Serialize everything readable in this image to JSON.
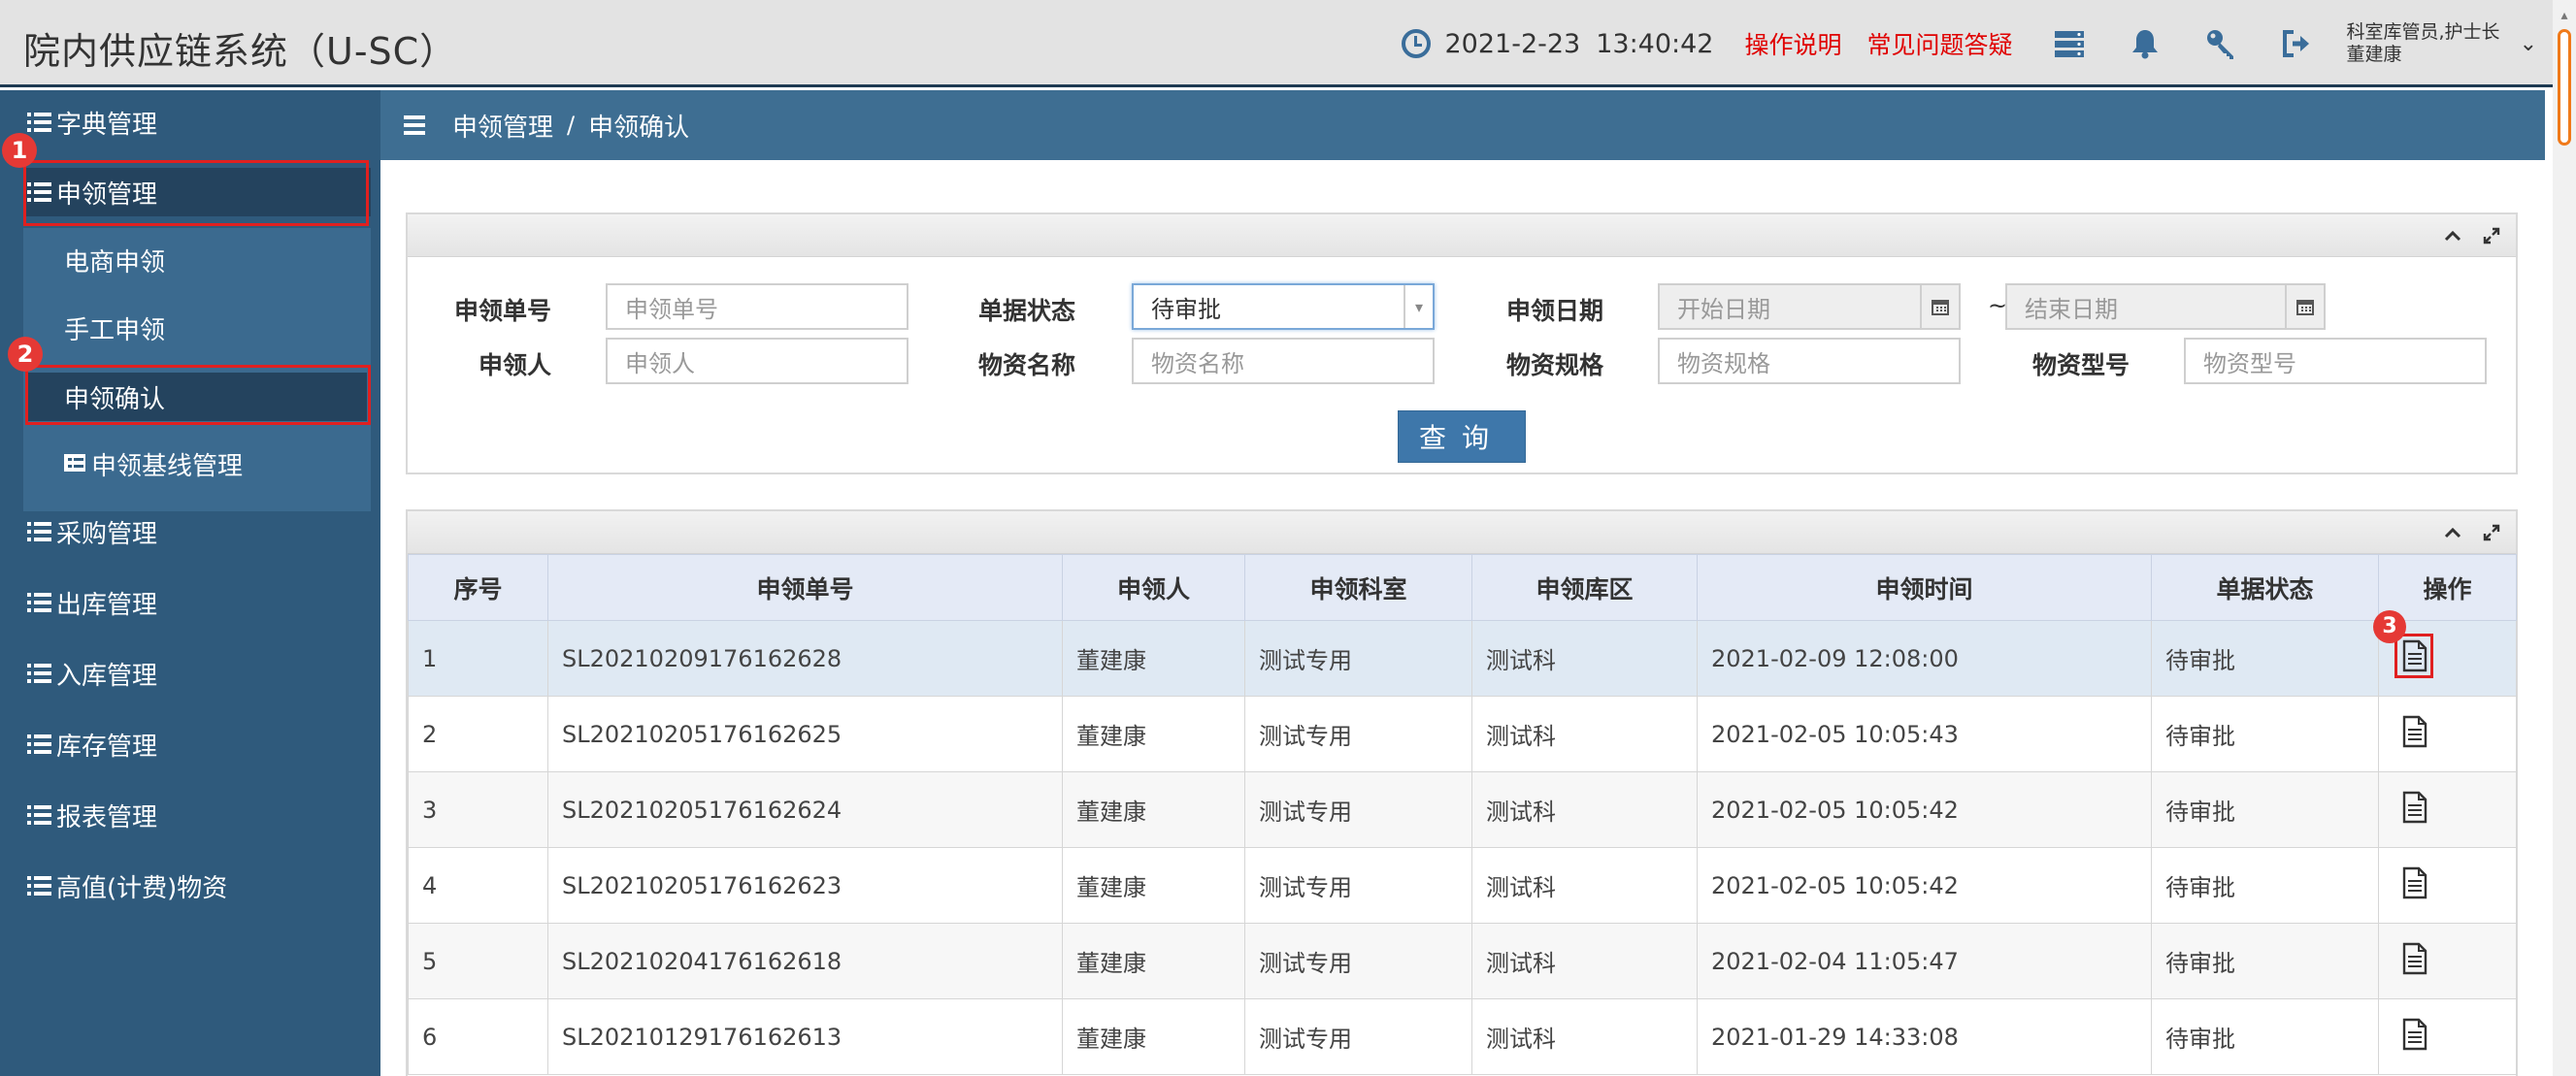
{
  "header": {
    "app_title": "院内供应链系统（U-SC）",
    "date": "2021-2-23",
    "time": "13:40:42",
    "help_link": "操作说明",
    "faq_link": "常见问题答疑",
    "user_line1": "科室库管员,护士长",
    "user_line2": "董建康",
    "icons": [
      "clock-icon",
      "server-icon",
      "bell-icon",
      "key-icon",
      "logout-icon",
      "chevron-down-icon"
    ]
  },
  "sidebar": {
    "items": [
      {
        "label": "字典管理"
      },
      {
        "label": "申领管理"
      },
      {
        "label": "采购管理"
      },
      {
        "label": "出库管理"
      },
      {
        "label": "入库管理"
      },
      {
        "label": "库存管理"
      },
      {
        "label": "报表管理"
      },
      {
        "label": "高值(计费)物资"
      }
    ],
    "sub_items": [
      {
        "label": "电商申领"
      },
      {
        "label": "手工申领"
      },
      {
        "label": "申领确认"
      },
      {
        "label": "申领基线管理"
      }
    ]
  },
  "annotations": {
    "badge1": "1",
    "badge2": "2",
    "badge3": "3"
  },
  "breadcrumb": {
    "parent": "申领管理",
    "separator": "/",
    "current": "申领确认"
  },
  "filter": {
    "order_no": {
      "label": "申领单号",
      "placeholder": "申领单号"
    },
    "status": {
      "label": "单据状态",
      "value": "待审批"
    },
    "date": {
      "label": "申领日期",
      "start_placeholder": "开始日期",
      "separator": "~",
      "end_placeholder": "结束日期"
    },
    "applicant": {
      "label": "申领人",
      "placeholder": "申领人"
    },
    "material_name": {
      "label": "物资名称",
      "placeholder": "物资名称"
    },
    "spec": {
      "label": "物资规格",
      "placeholder": "物资规格"
    },
    "model": {
      "label": "物资型号",
      "placeholder": "物资型号"
    },
    "query_button": "查询"
  },
  "table": {
    "columns": [
      "序号",
      "申领单号",
      "申领人",
      "申领科室",
      "申领库区",
      "申领时间",
      "单据状态",
      "操作"
    ],
    "rows": [
      [
        "1",
        "SL20210209176162628",
        "董建康",
        "测试专用",
        "测试科",
        "2021-02-09 12:08:00",
        "待审批"
      ],
      [
        "2",
        "SL20210205176162625",
        "董建康",
        "测试专用",
        "测试科",
        "2021-02-05 10:05:43",
        "待审批"
      ],
      [
        "3",
        "SL20210205176162624",
        "董建康",
        "测试专用",
        "测试科",
        "2021-02-05 10:05:42",
        "待审批"
      ],
      [
        "4",
        "SL20210205176162623",
        "董建康",
        "测试专用",
        "测试科",
        "2021-02-05 10:05:42",
        "待审批"
      ],
      [
        "5",
        "SL20210204176162618",
        "董建康",
        "测试专用",
        "测试科",
        "2021-02-04 11:05:47",
        "待审批"
      ],
      [
        "6",
        "SL20210129176162613",
        "董建康",
        "测试专用",
        "测试科",
        "2021-01-29 14:33:08",
        "待审批"
      ]
    ]
  }
}
